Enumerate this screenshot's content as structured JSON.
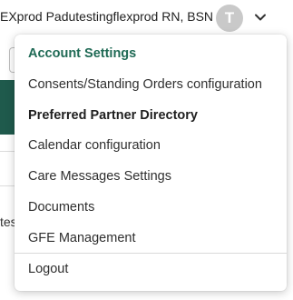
{
  "header": {
    "user_name": "EXprod Padutestingflexprod RN, BSN",
    "avatar_initial": "T",
    "dropdown_icon": "chevron-down-icon"
  },
  "background": {
    "text_fragment": "tes"
  },
  "menu": {
    "items": [
      {
        "label": "Account Settings"
      },
      {
        "label": "Consents/Standing Orders configuration"
      },
      {
        "label": "Preferred Partner Directory"
      },
      {
        "label": "Calendar configuration"
      },
      {
        "label": "Care Messages Settings"
      },
      {
        "label": "Documents"
      },
      {
        "label": "GFE Management"
      },
      {
        "label": "Logout"
      }
    ]
  },
  "colors": {
    "accent": "#1f6a55",
    "avatar_bg": "#c9c9c9",
    "band": "#1f5a4c"
  }
}
